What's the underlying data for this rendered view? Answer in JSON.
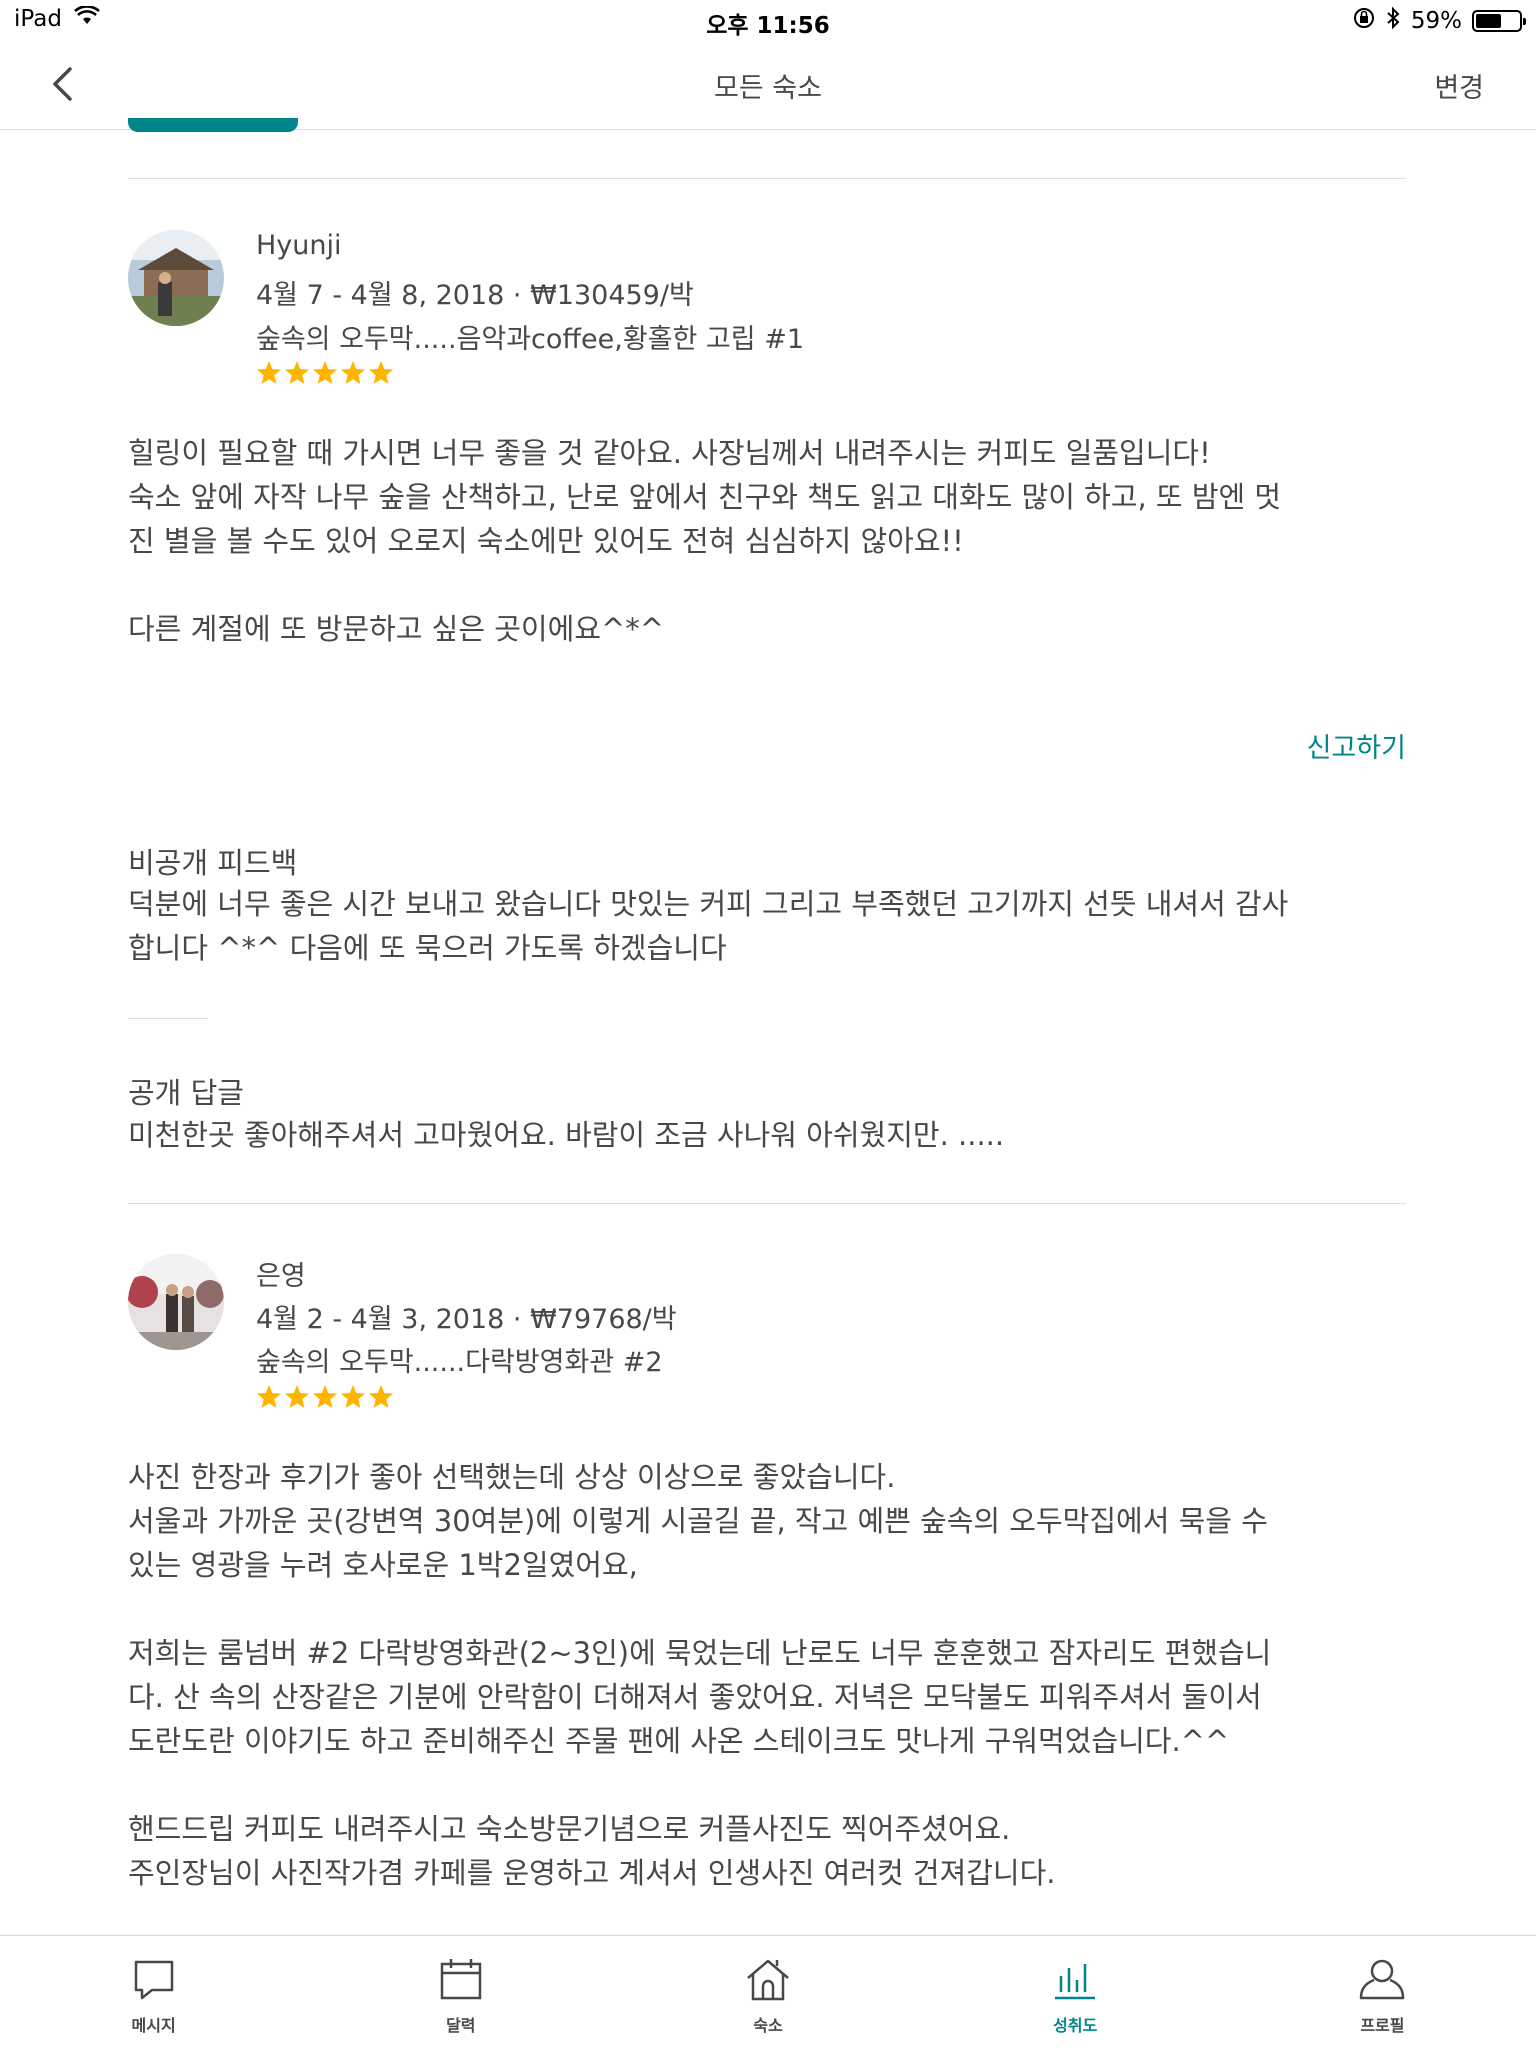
{
  "status_bar": {
    "device": "iPad",
    "time": "오후 11:56",
    "battery_percent": "59%",
    "battery_level": 0.59
  },
  "nav": {
    "title": "모든 숙소",
    "action": "변경"
  },
  "reviews": [
    {
      "guest_name": "Hyunji",
      "stay": "4월 7 - 4월 8, 2018 · ₩130459/박",
      "listing": "숲속의 오두막.....음악과coffee,황홀한 고립 #1",
      "rating": 5,
      "body": [
        "힐링이 필요할 때 가시면 너무 좋을 것 같아요. 사장님께서 내려주시는 커피도 일품입니다!",
        "숙소 앞에 자작 나무 숲을 산책하고, 난로 앞에서 친구와 책도 읽고 대화도 많이 하고, 또 밤엔 멋",
        "진 별을 볼 수도 있어 오로지 숙소에만 있어도 전혀 심심하지 않아요!!",
        "",
        "다른 계절에 또 방문하고 싶은 곳이에요^*^"
      ],
      "report_label": "신고하기",
      "private_feedback": {
        "title": "비공개 피드백",
        "lines": [
          "덕분에 너무 좋은 시간 보내고 왔습니다 맛있는 커피 그리고 부족했던 고기까지 선뜻 내셔서 감사",
          "합니다 ^*^ 다음에 또 묵으러 가도록 하겠습니다"
        ]
      },
      "public_reply": {
        "title": "공개 답글",
        "text": "미천한곳 좋아해주셔서 고마웠어요. 바람이 조금 사나워 아쉬웠지만. ....."
      }
    },
    {
      "guest_name": "은영",
      "stay": "4월 2 - 4월 3, 2018 · ₩79768/박",
      "listing": "숲속의 오두막......다락방영화관 #2",
      "rating": 5,
      "body": [
        "사진 한장과 후기가 좋아 선택했는데 상상 이상으로 좋았습니다.",
        "서울과 가까운 곳(강변역 30여분)에 이렇게 시골길 끝, 작고 예쁜 숲속의 오두막집에서 묵을 수",
        "있는 영광을 누려 호사로운 1박2일였어요,",
        "",
        "저희는 룸넘버 #2 다락방영화관(2~3인)에 묵었는데 난로도 너무 훈훈했고 잠자리도 편했습니",
        "다. 산 속의 산장같은 기분에 안락함이 더해져서 좋았어요. 저녁은 모닥불도 피워주셔서 둘이서",
        "도란도란 이야기도 하고 준비해주신 주물 팬에 사온 스테이크도 맛나게 구워먹었습니다.^^",
        "",
        "핸드드립 커피도 내려주시고 숙소방문기념으로 커플사진도 찍어주셨어요.",
        "주인장님이 사진작가겸 카페를 운영하고 계셔서 인생사진 여러컷 건져갑니다."
      ]
    }
  ],
  "tabs": [
    {
      "label": "메시지",
      "icon": "message-icon",
      "active": false
    },
    {
      "label": "달력",
      "icon": "calendar-icon",
      "active": false
    },
    {
      "label": "숙소",
      "icon": "home-icon",
      "active": false
    },
    {
      "label": "성취도",
      "icon": "stats-icon",
      "active": true
    },
    {
      "label": "프로필",
      "icon": "profile-icon",
      "active": false
    }
  ],
  "colors": {
    "accent": "#00868a",
    "text": "#484848",
    "star": "#ffb400"
  }
}
